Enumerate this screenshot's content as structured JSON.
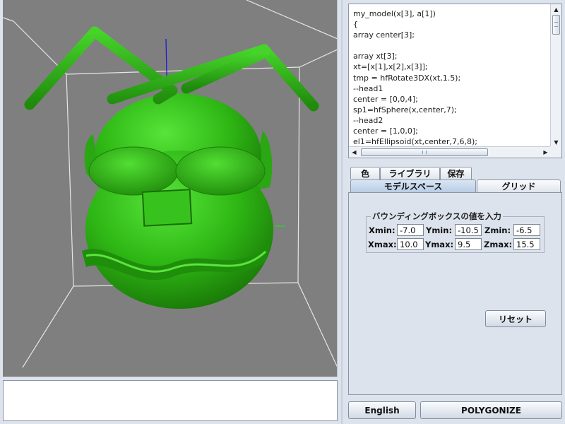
{
  "code_editor": {
    "text": "my_model(x[3], a[1])\n{\narray center[3];\n\narray xt[3];\nxt=[x[1],x[2],x[3]];\ntmp = hfRotate3DX(xt,1.5);\n--head1\ncenter = [0,0,4];\nsp1=hfSphere(x,center,7);\n--head2\ncenter = [1,0,0];\nel1=hfEllipsoid(xt,center,7,6,8);"
  },
  "tabs_top": [
    {
      "label": "色"
    },
    {
      "label": "ライブラリ"
    },
    {
      "label": "保存"
    }
  ],
  "tabs_second": [
    {
      "label": "モデルスペース",
      "selected": true
    },
    {
      "label": "グリッド",
      "selected": false
    }
  ],
  "bounding_box": {
    "title": "バウンディングボックスの値を入力",
    "xmin_label": "Xmin:",
    "xmin": "-7.0",
    "ymin_label": "Ymin:",
    "ymin": "-10.5",
    "zmin_label": "Zmin:",
    "zmin": "-6.5",
    "xmax_label": "Xmax:",
    "xmax": "10.0",
    "ymax_label": "Ymax:",
    "ymax": "9.5",
    "zmax_label": "Zmax:",
    "zmax": "15.5"
  },
  "reset_label": "リセット",
  "footer": {
    "english_label": "English",
    "polygonize_label": "POLYGONIZE"
  },
  "colors": {
    "viewport_bg": "#7f7f7f",
    "model_green": "#33c11a",
    "panel_bg": "#dde3ec"
  }
}
